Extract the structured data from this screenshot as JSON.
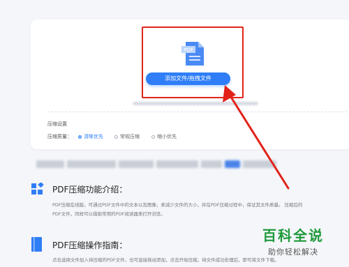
{
  "upload": {
    "button_label": "添加文件/拖拽文件",
    "file_icon_label": "PDF"
  },
  "settings": {
    "title": "压缩设置",
    "level_label": "压缩质量：",
    "options": [
      "清晰优先",
      "常规压缩",
      "缩小优先"
    ],
    "selected_index": 0
  },
  "sections": [
    {
      "title": "PDF压缩功能介绍：",
      "text_lines": [
        "PDF压缩在线版，可通过PDF文件中的文本以及图像，来减少文件的大小，并在PDF压缩过程中，保证其文件质量。 压缩后的",
        "PDF文件，同样可以借助常用的PDF阅读器来打开浏览。"
      ]
    },
    {
      "title": "PDF压缩操作指南：",
      "text_lines": [
        "点击选择文件加入待压缩的PDF文件，也可直接拖动添加，点击开始压缩，待文件成功处理后，即可将文件下载。"
      ]
    }
  ],
  "watermark": {
    "main": "百科全说",
    "sub": "助你轻松解决"
  },
  "colors": {
    "accent": "#2f7ef7",
    "highlight": "#e2231a",
    "watermark": "#1f9a3a"
  },
  "icons": [
    "pdf-file-icon",
    "grid-icon",
    "book-icon",
    "arrow-annotation"
  ]
}
